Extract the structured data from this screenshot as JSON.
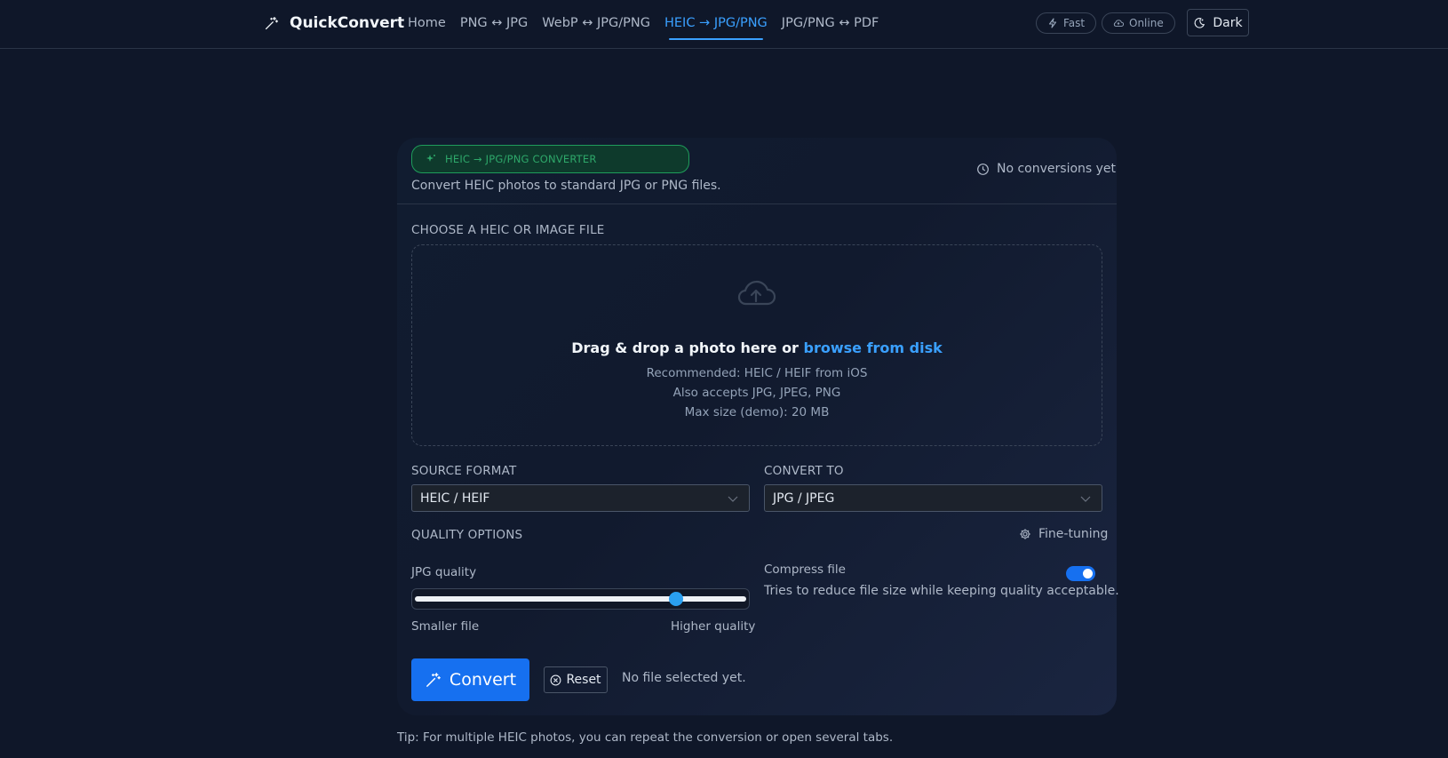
{
  "brand": {
    "name": "QuickConvert",
    "icon": "magic-wand-icon"
  },
  "nav": [
    {
      "label": "Home",
      "active": false
    },
    {
      "label": "PNG ↔ JPG",
      "active": false
    },
    {
      "label": "WebP ↔ JPG/PNG",
      "active": false
    },
    {
      "label": "HEIC → JPG/PNG",
      "active": true
    },
    {
      "label": "JPG/PNG ↔ PDF",
      "active": false
    }
  ],
  "header_pills": {
    "fast": "Fast",
    "online": "Online"
  },
  "theme_button": "Dark",
  "card": {
    "badge": "HEIC → JPG/PNG CONVERTER",
    "subtitle": "Convert HEIC photos to standard JPG or PNG files.",
    "history": "No conversions yet"
  },
  "upload": {
    "label": "CHOOSE A HEIC OR IMAGE FILE",
    "title_prefix": "Drag & drop a photo here or ",
    "title_link": "browse from disk",
    "recommended": "Recommended: HEIC / HEIF from iOS",
    "accepts": "Also accepts JPG, JPEG, PNG",
    "max_size": "Max size (demo): 20 MB"
  },
  "source_format": {
    "label": "SOURCE FORMAT",
    "value": "HEIC / HEIF"
  },
  "convert_to": {
    "label": "CONVERT TO",
    "value": "JPG / JPEG"
  },
  "quality": {
    "label": "QUALITY OPTIONS",
    "fine_tuning": "Fine-tuning",
    "slider_label": "JPG quality",
    "slider_value_fraction": 0.8,
    "min_label": "Smaller file",
    "max_label": "Higher quality"
  },
  "compress": {
    "label": "Compress file",
    "description": "Tries to reduce file size while keeping quality acceptable.",
    "enabled": true
  },
  "actions": {
    "convert": "Convert",
    "reset": "Reset",
    "status": "No file selected yet."
  },
  "tip": "Tip: For multiple HEIC photos, you can repeat the conversion or open several tabs.",
  "colors": {
    "accent": "#1670f0",
    "link": "#3aa0ff",
    "badge_green": "#2ea86a",
    "background": "#0f1729"
  }
}
